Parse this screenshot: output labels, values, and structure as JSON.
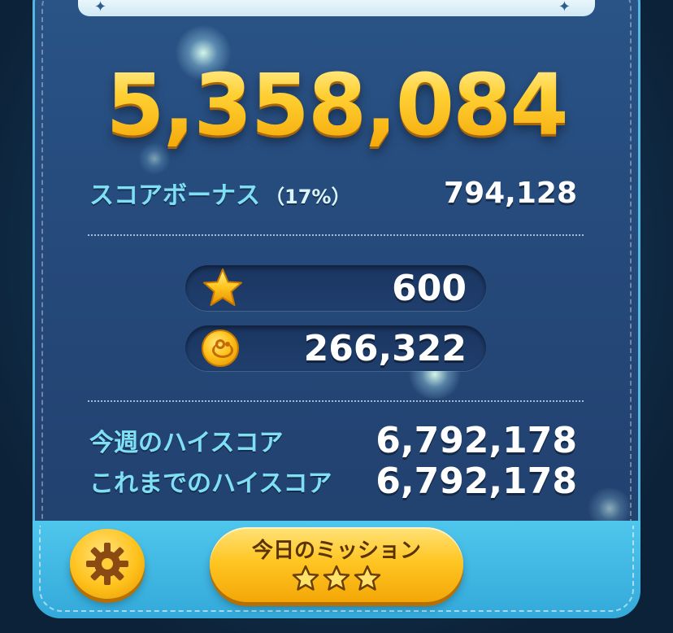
{
  "score": "5,358,084",
  "bonus": {
    "label": "スコアボーナス",
    "percent": "（17%）",
    "value": "794,128"
  },
  "stars": {
    "icon": "star-icon",
    "value": "600"
  },
  "coins": {
    "icon": "coin-icon",
    "value": "266,322"
  },
  "weekly_high": {
    "label": "今週のハイスコア",
    "value": "6,792,178"
  },
  "all_time_high": {
    "label": "これまでのハイスコア",
    "value": "6,792,178"
  },
  "mission_button": {
    "label": "今日のミッション",
    "stars": 3
  },
  "settings_button": {
    "icon": "gear-icon"
  },
  "colors": {
    "score_gold": "#ffc21a",
    "label_cyan": "#7fe0f5",
    "panel_blue": "#25497a",
    "button_gold": "#ffc624"
  }
}
